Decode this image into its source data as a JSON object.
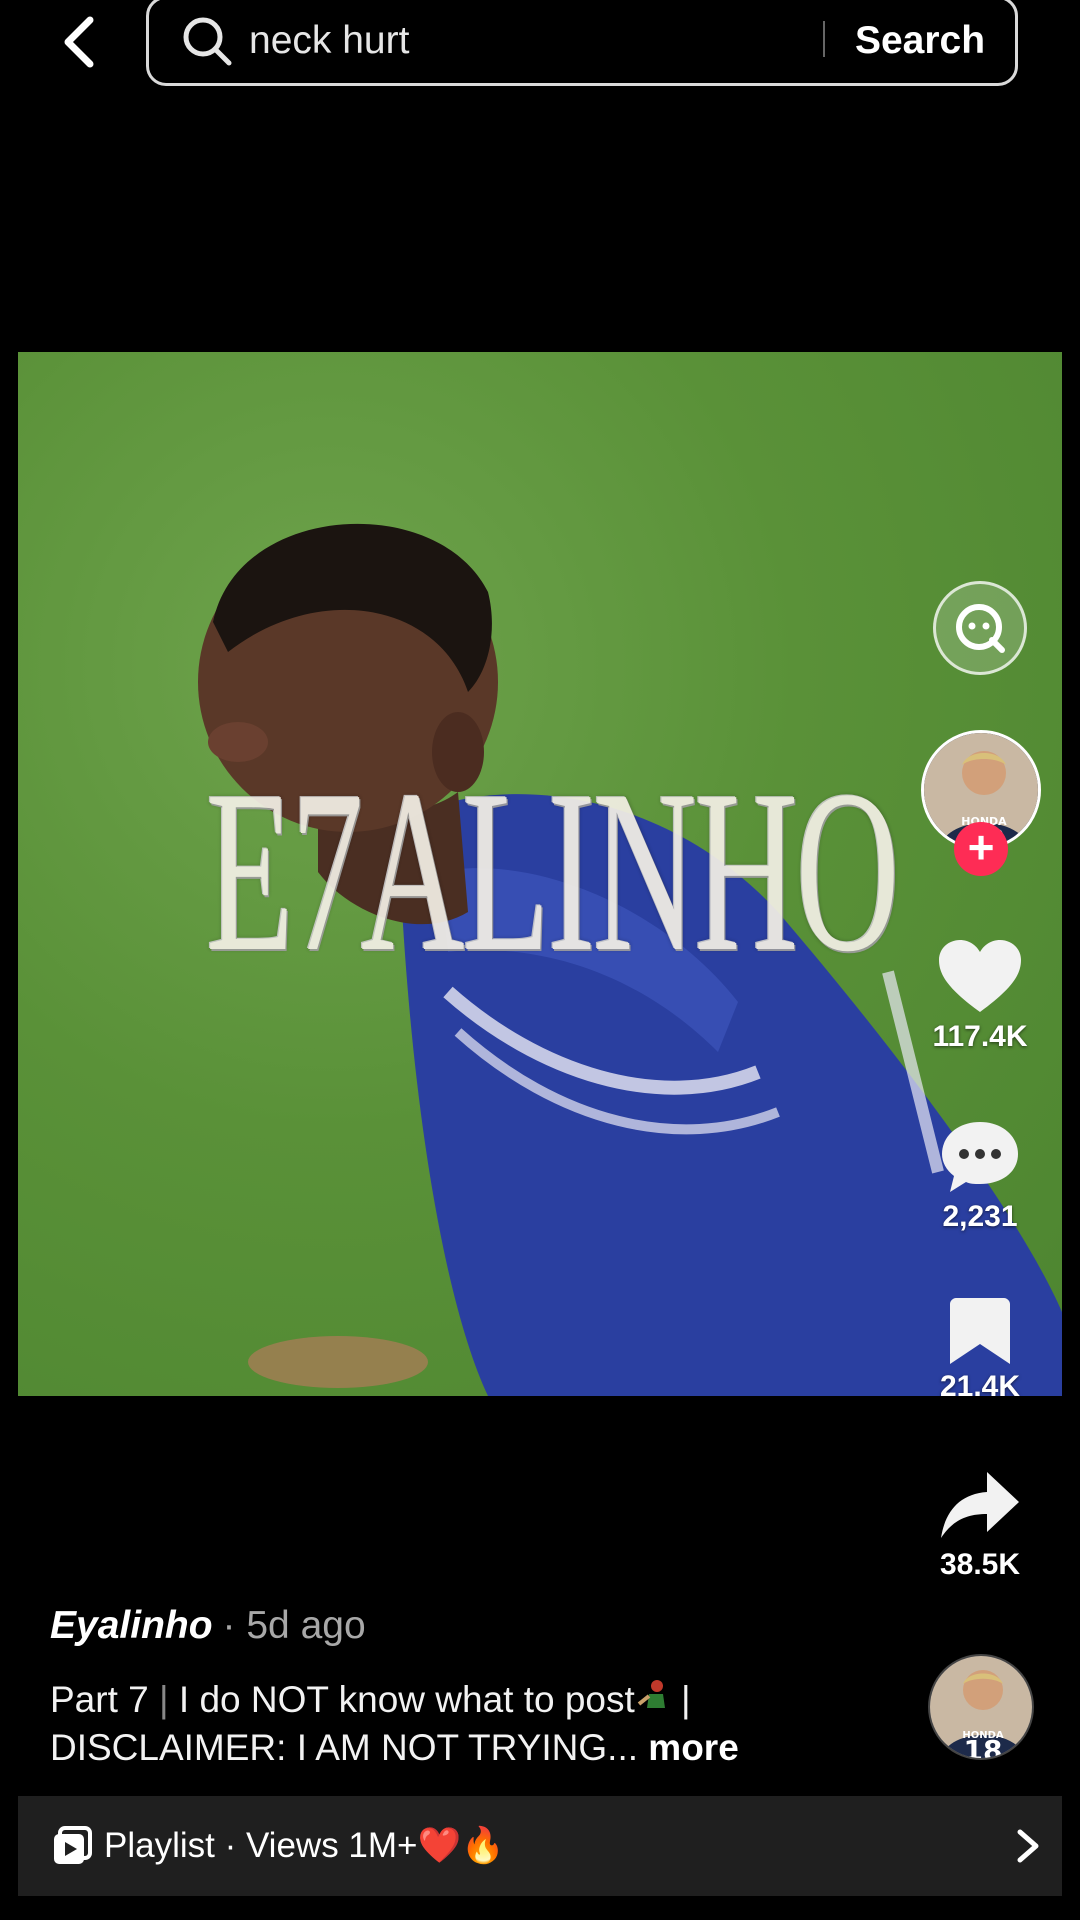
{
  "search": {
    "query": "neck hurt",
    "button_label": "Search"
  },
  "video": {
    "overlay_text": "E7ALINHO"
  },
  "actions": {
    "likes": "117.4K",
    "comments": "2,231",
    "saves": "21.4K",
    "shares": "38.5K"
  },
  "avatar": {
    "jersey_brand": "HONDA",
    "jersey_number": "18"
  },
  "post": {
    "author": "Eyalinho",
    "time": "· 5d ago",
    "caption_line1_a": "Part 7 ",
    "caption_sep1": "|",
    "caption_line1_b": " I do NOT know what to post",
    "caption_line1_c": " |",
    "caption_line2": "DISCLAIMER: I AM NOT TRYING...",
    "more_label": " more"
  },
  "playlist": {
    "label": "Playlist · Views 1M+❤️🔥"
  },
  "colors": {
    "accent_red": "#fe2c55",
    "pitch_green": "#5a9138",
    "jersey_blue": "#2a3fa0"
  },
  "icons": [
    "back-arrow-icon",
    "search-icon",
    "search-lens-icon",
    "heart-icon",
    "comment-icon",
    "bookmark-icon",
    "share-icon",
    "playlist-icon",
    "chevron-right-icon"
  ]
}
